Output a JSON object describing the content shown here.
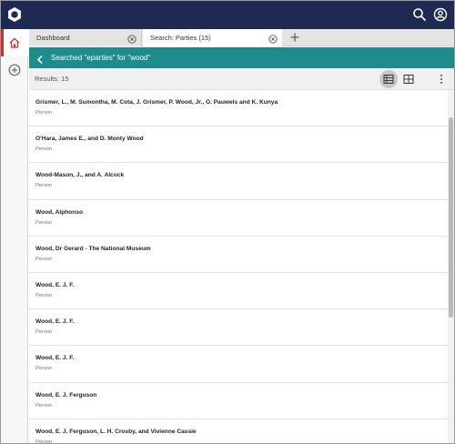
{
  "app": {
    "brand_color": "#1f2a52",
    "accent_color": "#1e8c8c",
    "logo_icon": "hexagon-logo-icon"
  },
  "topbar": {
    "search_icon": "search-icon",
    "user_icon": "user-account-icon"
  },
  "rail": {
    "items": [
      {
        "icon": "home-icon",
        "active": true
      },
      {
        "icon": "add-circle-icon",
        "active": false
      }
    ]
  },
  "tabs": [
    {
      "label": "Dashboard",
      "active": false
    },
    {
      "label": "Search: Parties (15)",
      "active": true
    }
  ],
  "search": {
    "title": "Searched \"eparties\" for \"wood\""
  },
  "toolbar": {
    "results_label": "Results: 15",
    "view_options": [
      "list-view-icon",
      "grid-view-icon"
    ],
    "more_icon": "more-vertical-icon"
  },
  "results": [
    {
      "name": "Grismer, L., M. Sumontha, M. Cota, J. Grismer, P. Wood, Jr., O. Pauwels and K. Kunya",
      "type": "Person"
    },
    {
      "name": "O'Hara, James E., and D. Monty Wood",
      "type": "Person"
    },
    {
      "name": "Wood-Mason, J., and A. Alcock",
      "type": "Person"
    },
    {
      "name": "Wood, Alphonso",
      "type": "Person"
    },
    {
      "name": "Wood, Dr Gerard - The National Museum",
      "type": "Person"
    },
    {
      "name": "Wood, E. J. F.",
      "type": "Person"
    },
    {
      "name": "Wood, E. J. F.",
      "type": "Person"
    },
    {
      "name": "Wood, E. J. F.",
      "type": "Person"
    },
    {
      "name": "Wood, E. J. Ferguson",
      "type": "Person"
    },
    {
      "name": "Wood, E. J. Ferguson, L. H. Crosby, and Vivienne Cassie",
      "type": "Person"
    }
  ]
}
